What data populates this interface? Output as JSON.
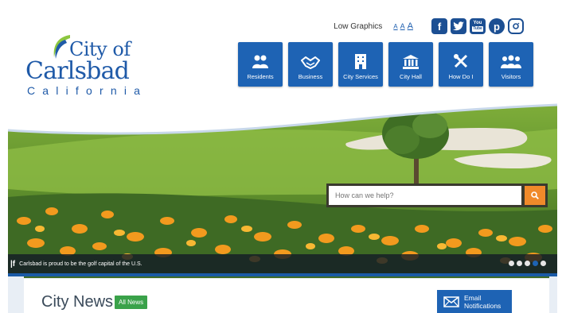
{
  "logo": {
    "line1": "City of",
    "line2": "Carlsbad",
    "line3": "California"
  },
  "utility": {
    "low_graphics": "Low Graphics",
    "text_sizes": [
      "A",
      "A",
      "A"
    ]
  },
  "social": [
    {
      "name": "facebook-icon",
      "glyph": "f"
    },
    {
      "name": "twitter-icon",
      "glyph": "t"
    },
    {
      "name": "youtube-icon",
      "glyph": "You"
    },
    {
      "name": "pinterest-icon",
      "glyph": "p"
    },
    {
      "name": "instagram-icon",
      "glyph": "◎"
    }
  ],
  "nav": [
    {
      "label": "Residents",
      "icon": "people-icon"
    },
    {
      "label": "Business",
      "icon": "handshake-icon"
    },
    {
      "label": "City Services",
      "icon": "building-icon"
    },
    {
      "label": "City Hall",
      "icon": "city-hall-icon"
    },
    {
      "label": "How Do I",
      "icon": "tools-icon"
    },
    {
      "label": "Visitors",
      "icon": "group-icon"
    }
  ],
  "search": {
    "placeholder": "How can we help?",
    "icon": "search-icon"
  },
  "hero": {
    "caption": "Carlsbad is proud to be the golf capital of the U.S.",
    "slide_count": 5,
    "active_slide": 4
  },
  "news": {
    "title": "City News",
    "all_news": "All News",
    "email_line1": "Email",
    "email_line2": "Notifications"
  },
  "colors": {
    "brand_blue": "#1e63b4",
    "accent_orange": "#f08a2a",
    "news_green": "#3aa24a"
  }
}
